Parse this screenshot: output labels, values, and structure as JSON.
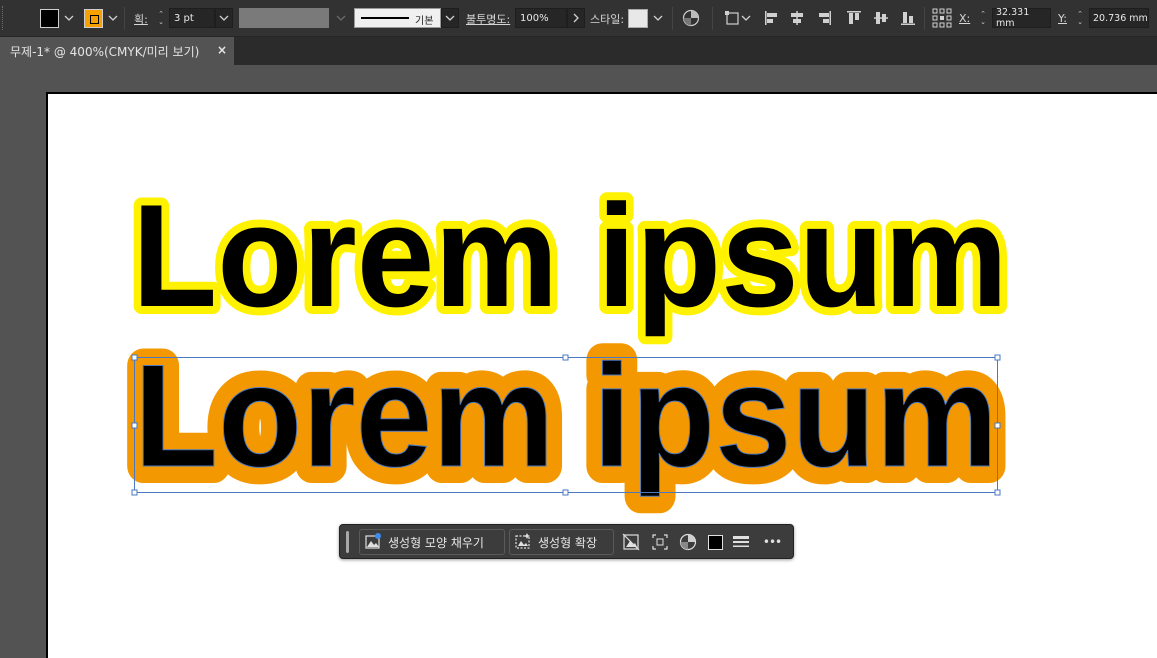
{
  "control_bar": {
    "stroke_label": "획:",
    "stroke_weight": "3 pt",
    "stroke_profile": "기본",
    "opacity_label": "불투명도:",
    "opacity_value": "100%",
    "style_label": "스타일:",
    "x_label": "X:",
    "x_value": "32.331 mm",
    "y_label": "Y:",
    "y_value": "20.736 mm",
    "colors": {
      "fill": "#000000",
      "stroke": "#F7A100"
    }
  },
  "document_tab": {
    "title": "무제-1* @ 400%(CMYK/미리 보기)",
    "close": "×"
  },
  "artwork": {
    "line1": {
      "text": "Lorem ipsum",
      "fill": "#000000",
      "outline": "#FFF200"
    },
    "line2": {
      "text": "Lorem ipsum",
      "fill": "#000000",
      "outline": "#F39800"
    }
  },
  "contextual_task_bar": {
    "generative_shape_fill": "생성형 모양 채우기",
    "generative_expand": "생성형 확장",
    "more": "•••"
  }
}
